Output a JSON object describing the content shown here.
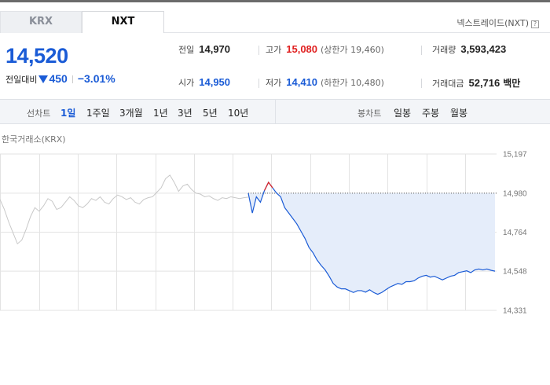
{
  "tabs": [
    {
      "label": "KRX",
      "active": false
    },
    {
      "label": "NXT",
      "active": true
    }
  ],
  "nxt_link": "넥스트레이드(NXT)",
  "help_icon": "?",
  "price": {
    "current": "14,520",
    "change_label": "전일대비",
    "change_amount": "450",
    "change_direction": "down",
    "change_pct": "−3.01%"
  },
  "stats": {
    "prev_close": {
      "label": "전일",
      "value": "14,970"
    },
    "high": {
      "label": "고가",
      "value": "15,080",
      "sub": "(상한가 19,460)"
    },
    "volume": {
      "label": "거래량",
      "value": "3,593,423"
    },
    "open": {
      "label": "시가",
      "value": "14,950"
    },
    "low": {
      "label": "저가",
      "value": "14,410",
      "sub": "(하한가 10,480)"
    },
    "amount": {
      "label": "거래대금",
      "value": "52,716",
      "unit": "백만"
    }
  },
  "period": {
    "line_label": "선차트",
    "line_options": [
      "1일",
      "1주일",
      "3개월",
      "1년",
      "3년",
      "5년",
      "10년"
    ],
    "active": "1일",
    "candle_label": "봉차트",
    "candle_options": [
      "일봉",
      "주봉",
      "월봉"
    ]
  },
  "chart_title": "한국거래소(KRX)",
  "colors": {
    "blue": "#1a5bd6",
    "red": "#e02020",
    "fill": "#e5edfa",
    "grey_line": "#c8c8c8"
  },
  "chart_data": {
    "type": "line",
    "title": "한국거래소(KRX)",
    "y_ticks": [
      "15,197",
      "14,980",
      "14,764",
      "14,548",
      "14,331"
    ],
    "ylim": [
      14331,
      15197
    ],
    "reference_line": 14980,
    "grid": true,
    "series": [
      {
        "style": "prior-session-grey",
        "values": [
          14945,
          14890,
          14820,
          14760,
          14700,
          14720,
          14780,
          14850,
          14900,
          14880,
          14910,
          14950,
          14935,
          14890,
          14900,
          14930,
          14960,
          14940,
          14910,
          14900,
          14920,
          14950,
          14940,
          14960,
          14930,
          14920,
          14950,
          14970,
          14960,
          14945,
          14955,
          14930,
          14920,
          14945,
          14955,
          14960,
          14985,
          15010,
          15060,
          15080,
          15040,
          14990,
          15020,
          15030,
          15000,
          14980,
          14975,
          14960,
          14965,
          14950,
          14940,
          14955,
          14950,
          14960,
          14955,
          14950,
          14955,
          14958
        ]
      },
      {
        "style": "today-blue",
        "values": [
          14980,
          14870,
          14960,
          14930,
          14995,
          15040,
          15010,
          14980,
          14960,
          14900,
          14870,
          14840,
          14810,
          14770,
          14730,
          14680,
          14650,
          14610,
          14580,
          14555,
          14520,
          14480,
          14460,
          14450,
          14450,
          14440,
          14430,
          14440,
          14440,
          14432,
          14445,
          14430,
          14420,
          14430,
          14445,
          14460,
          14470,
          14480,
          14475,
          14490,
          14490,
          14495,
          14510,
          14520,
          14525,
          14515,
          14520,
          14510,
          14500,
          14510,
          14520,
          14525,
          14540,
          14545,
          14550,
          14540,
          14555,
          14560,
          14555,
          14560,
          14553,
          14548
        ]
      }
    ]
  }
}
